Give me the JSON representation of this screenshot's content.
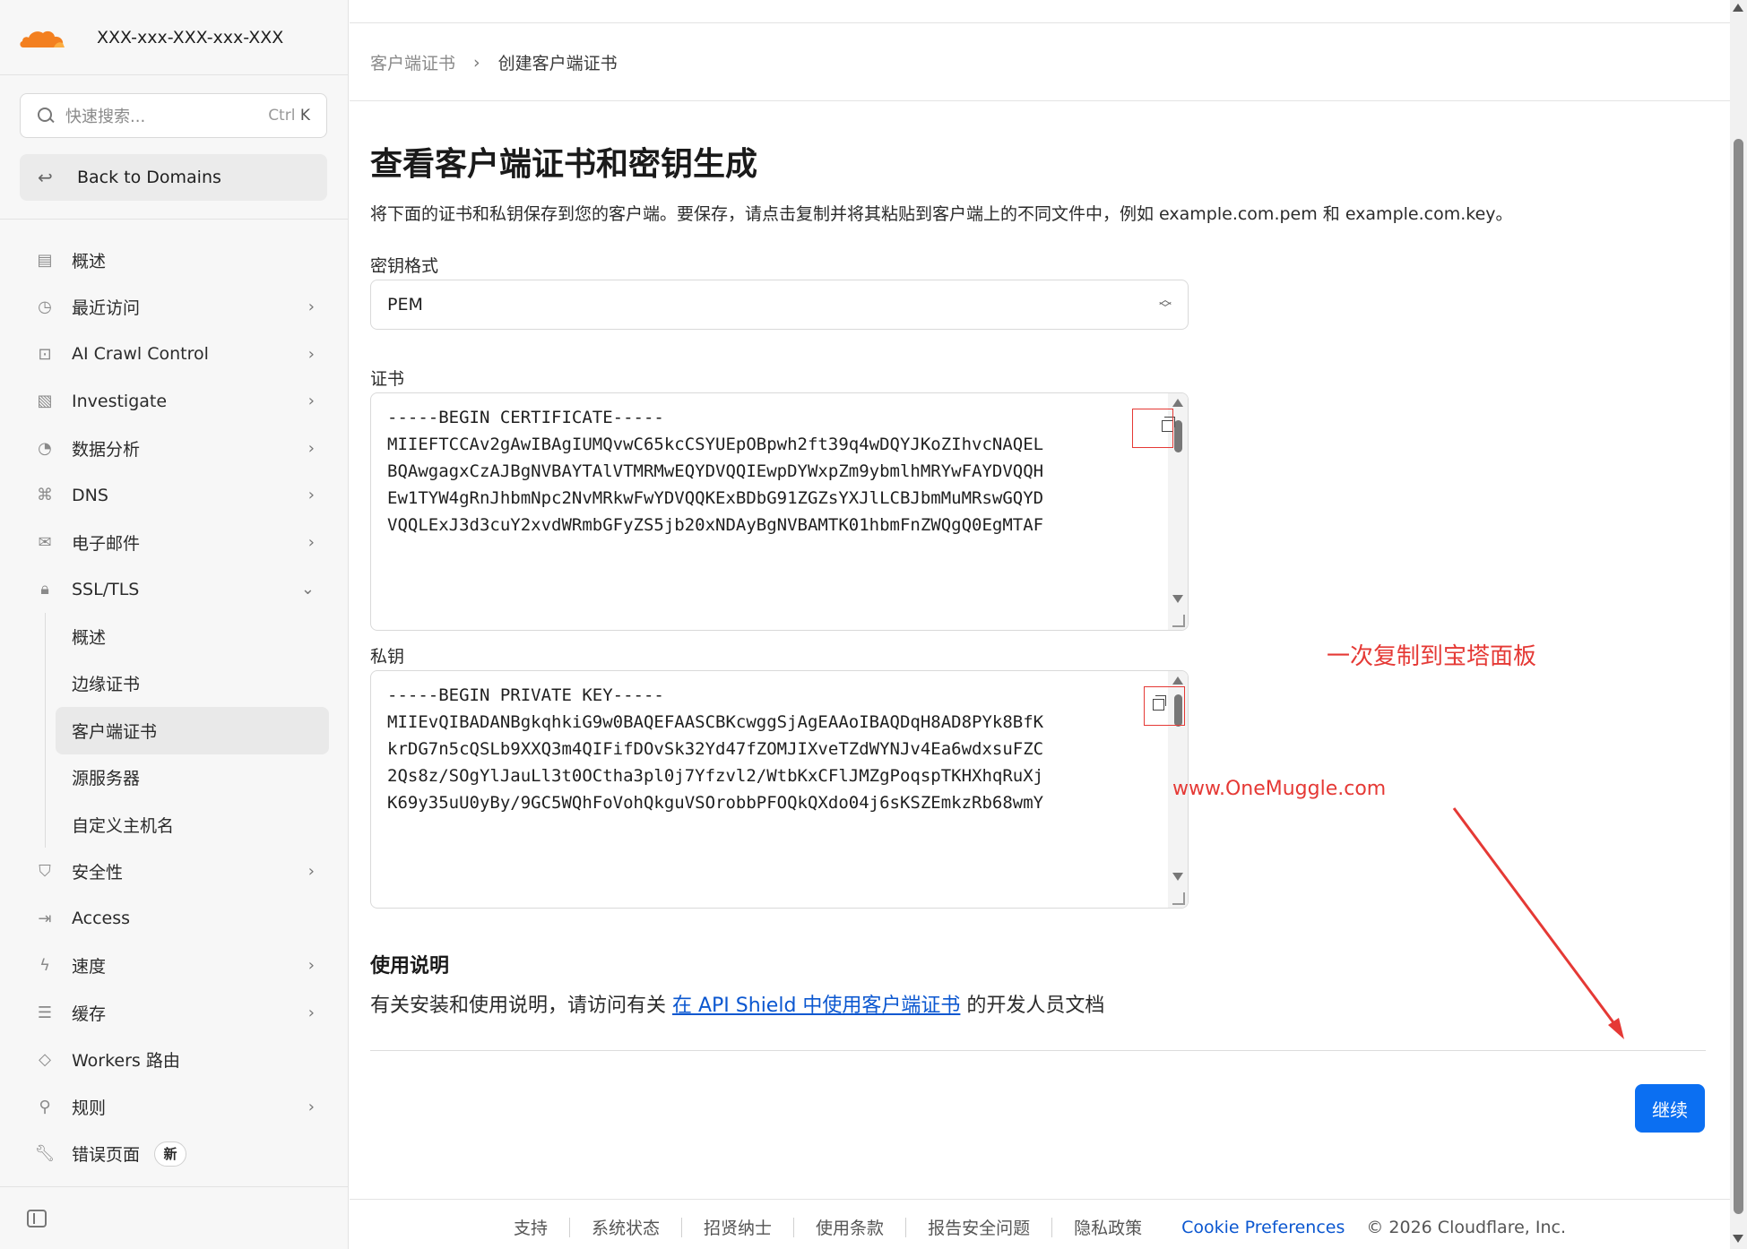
{
  "sidebar": {
    "account": "XXX-xxx-XXX-xxx-XXX",
    "search": {
      "placeholder": "快速搜索...",
      "shortcut_prefix": "Ctrl",
      "shortcut_key": "K"
    },
    "back": "Back to Domains",
    "nav": [
      {
        "label": "概述",
        "icon": "doc-icon",
        "chevron": ""
      },
      {
        "label": "最近访问",
        "icon": "history-icon",
        "chevron": "›"
      },
      {
        "label": "AI Crawl Control",
        "icon": "robot-icon",
        "chevron": "›"
      },
      {
        "label": "Investigate",
        "icon": "file-search-icon",
        "chevron": "›"
      },
      {
        "label": "数据分析",
        "icon": "pie-icon",
        "chevron": "›"
      },
      {
        "label": "DNS",
        "icon": "network-icon",
        "chevron": "›"
      },
      {
        "label": "电子邮件",
        "icon": "mail-icon",
        "chevron": "›"
      },
      {
        "label": "SSL/TLS",
        "icon": "lock-icon",
        "chevron": "⌄"
      }
    ],
    "sub": [
      "概述",
      "边缘证书",
      "客户端证书",
      "源服务器",
      "自定义主机名"
    ],
    "nav2": [
      {
        "label": "安全性",
        "icon": "shield-icon",
        "chevron": "›"
      },
      {
        "label": "Access",
        "icon": "access-icon",
        "chevron": ""
      },
      {
        "label": "速度",
        "icon": "bolt-icon",
        "chevron": "›"
      },
      {
        "label": "缓存",
        "icon": "storage-icon",
        "chevron": "›"
      },
      {
        "label": "Workers 路由",
        "icon": "diamond-icon",
        "chevron": ""
      },
      {
        "label": "规则",
        "icon": "funnel-icon",
        "chevron": "›"
      },
      {
        "label": "错误页面",
        "icon": "wrench-icon",
        "chevron": "",
        "badge": "新"
      }
    ]
  },
  "breadcrumb": {
    "parent": "客户端证书",
    "sep": "›",
    "current": "创建客户端证书"
  },
  "page": {
    "title": "查看客户端证书和密钥生成",
    "description": "将下面的证书和私钥保存到您的客户端。要保存，请点击复制并将其粘贴到客户端上的不同文件中，例如 example.com.pem 和 example.com.key。",
    "key_format_label": "密钥格式",
    "key_format_value": "PEM",
    "cert_label": "证书",
    "cert_text": "-----BEGIN CERTIFICATE-----\nMIIEFTCCAv2gAwIBAgIUMQvwC65kcCSYUEpOBpwh2ft39q4wDQYJKoZIhvcNAQEL\nBQAwgagxCzAJBgNVBAYTAlVTMRMwEQYDVQQIEwpDYWxpZm9ybmlhMRYwFAYDVQQH\nEw1TYW4gRnJhbmNpc2NvMRkwFwYDVQQKExBDbG91ZGZsYXJlLCBJbmMuMRswGQYD\nVQQLExJ3d3cuY2xvdWRmbGFyZS5jb20xNDAyBgNVBAMTK01hbmFnZWQgQ0EgMTAF",
    "key_label": "私钥",
    "key_text": "-----BEGIN PRIVATE KEY-----\nMIIEvQIBADANBgkqhkiG9w0BAQEFAASCBKcwggSjAgEAAoIBAQDqH8AD8PYk8BfK\nkrDG7n5cQSLb9XXQ3m4QIFifDOvSk32Yd47fZOMJIXveTZdWYNJv4Ea6wdxsuFZC\n2Qs8z/SOgYlJauLl3t0OCtha3pl0j7Yfzvl2/WtbKxCFlJMZgPoqspTKHXhqRuXj\nK69y35uU0yBy/9GC5WQhFoVohQkguVSOrobbPFOQkQXdo04j6sKSZEmkzRb68wmY",
    "usage_title": "使用说明",
    "usage_prefix": "有关安装和使用说明，请访问有关 ",
    "usage_link": "在 API Shield 中使用客户端证书",
    "usage_suffix": " 的开发人员文档",
    "continue": "继续"
  },
  "annotations": {
    "note": "一次复制到宝塔面板",
    "watermark": "www.OneMuggle.com"
  },
  "footer": {
    "links": [
      "支持",
      "系统状态",
      "招贤纳士",
      "使用条款",
      "报告安全问题",
      "隐私政策"
    ],
    "cookie": "Cookie Preferences",
    "copyright": "© 2026 Cloudflare, Inc."
  },
  "colors": {
    "accent": "#0b6ff2",
    "link": "#0b57d0",
    "annotation": "#e53935",
    "logo": "#f38020"
  }
}
